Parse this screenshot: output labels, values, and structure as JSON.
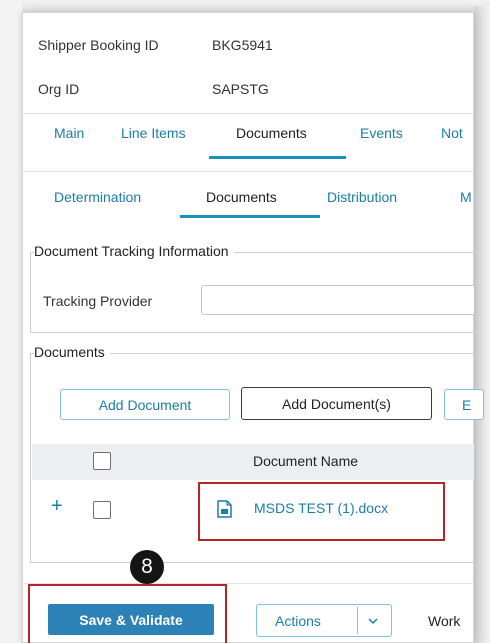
{
  "header": {
    "booking_label": "Shipper Booking ID",
    "booking_value": "BKG5941",
    "org_label": "Org ID",
    "org_value": "SAPSTG"
  },
  "tabs": [
    "Main",
    "Line Items",
    "Documents",
    "Events",
    "Not"
  ],
  "subtabs": [
    "Determination",
    "Documents",
    "Distribution",
    "M"
  ],
  "tracking": {
    "section_title": "Document Tracking Information",
    "provider_label": "Tracking Provider",
    "provider_value": ""
  },
  "documents": {
    "section_title": "Documents",
    "buttons": [
      "Add Document",
      "Add Document(s)",
      "E"
    ],
    "column_header": "Document Name",
    "rows": [
      {
        "expand": "+",
        "name": "MSDS TEST (1).docx"
      }
    ]
  },
  "callout": "8",
  "footer": {
    "save_label": "Save & Validate",
    "actions_label": "Actions",
    "workflow_partial": "Work"
  },
  "colors": {
    "accent": "#2c82b7",
    "link": "#1b7ea6",
    "highlight": "#b3262b"
  }
}
